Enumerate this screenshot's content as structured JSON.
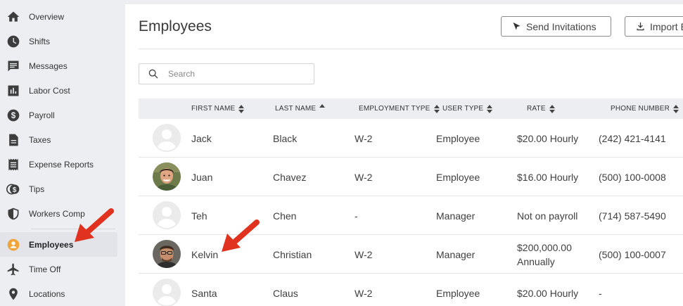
{
  "sidebar": {
    "items": [
      {
        "label": "Overview",
        "icon": "home-icon"
      },
      {
        "label": "Shifts",
        "icon": "clock-icon"
      },
      {
        "label": "Messages",
        "icon": "message-icon"
      },
      {
        "label": "Labor Cost",
        "icon": "bar-chart-icon"
      },
      {
        "label": "Payroll",
        "icon": "dollar-icon"
      },
      {
        "label": "Taxes",
        "icon": "document-icon"
      },
      {
        "label": "Expense Reports",
        "icon": "receipt-icon"
      },
      {
        "label": "Tips",
        "icon": "tips-icon"
      },
      {
        "label": "Workers Comp",
        "icon": "shield-icon"
      },
      {
        "label": "Employees",
        "icon": "person-icon"
      },
      {
        "label": "Time Off",
        "icon": "airplane-icon"
      },
      {
        "label": "Locations",
        "icon": "location-pin-icon"
      }
    ],
    "active": "Employees"
  },
  "header": {
    "title": "Employees",
    "send_invitations_label": "Send Invitations",
    "import_label": "Import E"
  },
  "search": {
    "placeholder": "Search",
    "value": ""
  },
  "table": {
    "columns": [
      "FIRST NAME",
      "LAST NAME",
      "EMPLOYMENT TYPE",
      "USER TYPE",
      "RATE",
      "PHONE NUMBER"
    ],
    "rows": [
      {
        "first": "Jack",
        "last": "Black",
        "emp_type": "W-2",
        "user_type": "Employee",
        "rate": "$20.00 Hourly",
        "rate2": "",
        "phone": "(242) 421-4141",
        "avatar": "blank"
      },
      {
        "first": "Juan",
        "last": "Chavez",
        "emp_type": "W-2",
        "user_type": "Employee",
        "rate": "$16.00 Hourly",
        "rate2": "",
        "phone": "(500) 100-0008",
        "avatar": "photo"
      },
      {
        "first": "Teh",
        "last": "Chen",
        "emp_type": "-",
        "user_type": "Manager",
        "rate": "Not on payroll",
        "rate2": "",
        "phone": "(714) 587-5490",
        "avatar": "blank"
      },
      {
        "first": "Kelvin",
        "last": "Christian",
        "emp_type": "W-2",
        "user_type": "Manager",
        "rate": "$200,000.00",
        "rate2": "Annually",
        "phone": "(500) 100-0007",
        "avatar": "photo"
      },
      {
        "first": "Santa",
        "last": "Claus",
        "emp_type": "W-2",
        "user_type": "Employee",
        "rate": "$20.00 Hourly",
        "rate2": "",
        "phone": "-",
        "avatar": "blank"
      }
    ]
  },
  "colors": {
    "accent": "#f0a43a",
    "annotation_arrow": "#e0321e",
    "sidebar_bg": "#eceef2"
  }
}
